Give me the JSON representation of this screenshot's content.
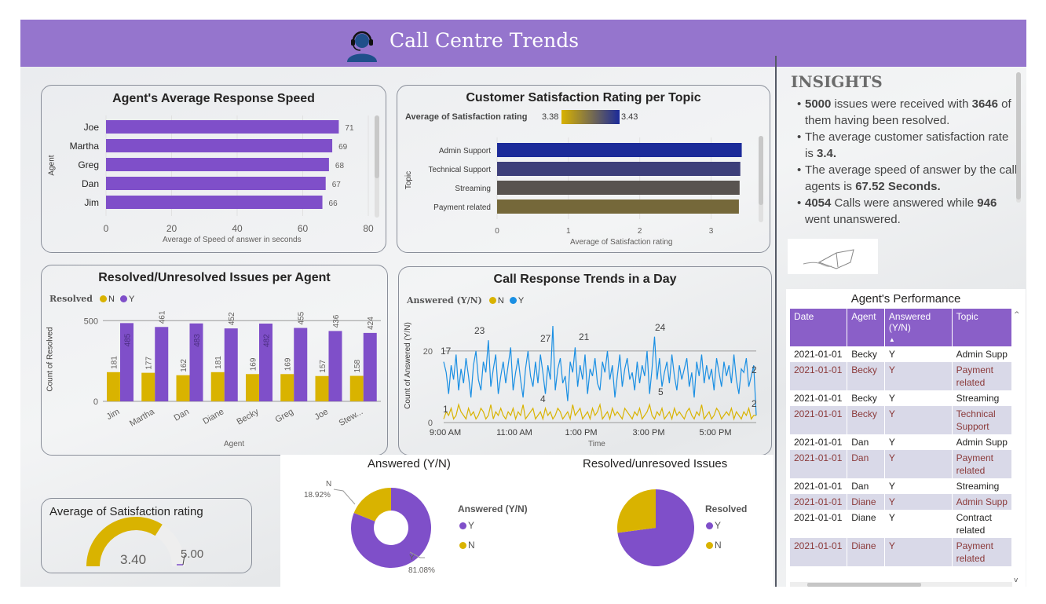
{
  "header": {
    "title": "Call Centre Trends",
    "logo_icon": "headset-agent-icon"
  },
  "colors": {
    "purple": "#7f4fc9",
    "gold": "#d9b300",
    "blue": "#1a8fe3",
    "navy": "#1b2a8f"
  },
  "response_speed": {
    "title": "Agent's Average Response Speed",
    "ylabel": "Agent",
    "xlabel": "Average of Speed of answer in seconds",
    "x_ticks": [
      "0",
      "20",
      "40",
      "60",
      "80"
    ],
    "chart_data": {
      "type": "bar",
      "categories": [
        "Joe",
        "Martha",
        "Greg",
        "Dan",
        "Jim"
      ],
      "values": [
        71,
        69,
        68,
        67,
        66
      ],
      "xlim": [
        0,
        80
      ]
    }
  },
  "satisfaction_topic": {
    "title": "Customer Satisfaction Rating per Topic",
    "legend_title": "Average of Satisfaction rating",
    "legend_min": "3.38",
    "legend_max": "3.43",
    "ylabel": "Topic",
    "xlabel": "Average of Satisfaction rating",
    "x_ticks": [
      "0",
      "1",
      "2",
      "3"
    ],
    "chart_data": {
      "type": "bar",
      "categories": [
        "Admin Support",
        "Technical Support",
        "Streaming",
        "Payment related"
      ],
      "values": [
        3.43,
        3.41,
        3.4,
        3.39
      ],
      "colors": [
        "#1c2b99",
        "#3d3f7a",
        "#585350",
        "#75683a"
      ],
      "xlim": [
        0,
        3.6
      ]
    }
  },
  "resolved_agent": {
    "title": "Resolved/Unresolved Issues per Agent",
    "legend_title": "Resolved",
    "legend_n": "N",
    "legend_y": "Y",
    "ylabel": "Count of Resolved",
    "xlabel": "Agent",
    "y_ticks": [
      "0",
      "500"
    ],
    "chart_data": {
      "type": "bar",
      "categories": [
        "Jim",
        "Martha",
        "Dan",
        "Diane",
        "Becky",
        "Greg",
        "Joe",
        "Stew..."
      ],
      "series": [
        {
          "name": "N",
          "values": [
            181,
            177,
            162,
            181,
            169,
            169,
            157,
            158
          ]
        },
        {
          "name": "Y",
          "values": [
            485,
            461,
            483,
            452,
            482,
            455,
            436,
            424
          ]
        }
      ],
      "ylim": [
        0,
        550
      ]
    }
  },
  "call_trends": {
    "title": "Call Response Trends in a Day",
    "legend_title": "Answered (Y/N)",
    "legend_n": "N",
    "legend_y": "Y",
    "ylabel": "Count of Answered (Y/N)",
    "xlabel": "Time",
    "y_ticks": [
      "0",
      "20"
    ],
    "x_ticks": [
      "9:00 AM",
      "11:00 AM",
      "1:00 PM",
      "3:00 PM",
      "5:00 PM"
    ],
    "annotations": [
      "17",
      "23",
      "27",
      "21",
      "24",
      "2",
      "2",
      "1",
      "4",
      "5"
    ],
    "chart_data": {
      "type": "line",
      "x_range": [
        "9:00 AM",
        "6:00 PM"
      ],
      "ylim": [
        0,
        27
      ],
      "series": [
        {
          "name": "Y",
          "values": [
            17,
            14,
            8,
            16,
            12,
            19,
            9,
            15,
            11,
            18,
            13,
            7,
            16,
            20,
            12,
            9,
            17,
            14,
            23,
            10,
            15,
            19,
            8,
            13,
            17,
            11,
            16,
            21,
            9,
            14,
            18,
            12,
            7,
            15,
            20,
            13,
            10,
            17,
            11,
            19,
            14,
            8,
            16,
            12,
            27,
            9,
            15,
            18,
            11,
            13,
            6,
            17,
            14,
            21,
            10,
            16,
            12,
            19,
            8,
            15,
            13,
            18,
            11,
            9,
            17,
            14,
            20,
            12,
            16,
            7,
            13,
            19,
            10,
            15,
            18,
            12,
            14,
            9,
            17,
            11,
            16,
            13,
            20,
            8,
            15,
            24,
            12,
            18,
            10,
            14,
            17,
            11,
            19,
            13,
            9,
            16,
            12,
            15,
            18,
            10,
            14,
            7,
            17,
            13,
            19,
            11,
            16,
            12,
            15,
            9,
            18,
            14,
            10,
            17,
            13,
            16,
            11,
            19,
            12,
            8,
            15,
            14,
            18,
            10,
            13,
            16,
            2
          ]
        },
        {
          "name": "N",
          "values": [
            1,
            3,
            2,
            4,
            1,
            2,
            5,
            3,
            2,
            1,
            4,
            2,
            3,
            1,
            2,
            4,
            3,
            1,
            2,
            5,
            1,
            3,
            2,
            4,
            2,
            1,
            3,
            2,
            4,
            1,
            3,
            2,
            5,
            1,
            2,
            3,
            4,
            1,
            2,
            3,
            1,
            4,
            2,
            3,
            1,
            2,
            4,
            3,
            1,
            2,
            3,
            1,
            5,
            2,
            3,
            4,
            1,
            2,
            3,
            1,
            4,
            2,
            3,
            5,
            1,
            2,
            3,
            1,
            4,
            2,
            3,
            2,
            1,
            4,
            3,
            2,
            1,
            3,
            2,
            4,
            1,
            2,
            3,
            5,
            2,
            1,
            3,
            2,
            4,
            1,
            2,
            3,
            1,
            4,
            2,
            3,
            2,
            1,
            3,
            4,
            2,
            1,
            3,
            2,
            5,
            1,
            2,
            3,
            1,
            2,
            4,
            3,
            1,
            2,
            3,
            2,
            4,
            1,
            3,
            2,
            1,
            3,
            2,
            4,
            1,
            2,
            2
          ]
        }
      ]
    }
  },
  "avg_satisfaction": {
    "title": "Average of Satisfaction rating",
    "value": "3.40",
    "max": "5.00",
    "chart_data": {
      "type": "gauge",
      "value": 3.4,
      "min": 0,
      "max": 5
    }
  },
  "answered_donut": {
    "title": "Answered (Y/N)",
    "legend_title": "Answered (Y/N)",
    "legend_y": "Y",
    "legend_n": "N",
    "label_n": "N",
    "label_n_pct": "18.92%",
    "label_y": "Y",
    "label_y_pct": "81.08%",
    "chart_data": {
      "type": "pie",
      "categories": [
        "Y",
        "N"
      ],
      "values": [
        81.08,
        18.92
      ]
    }
  },
  "resolved_donut": {
    "title": "Resolved/unresoved Issues",
    "legend_title": "Resolved",
    "legend_y": "Y",
    "legend_n": "N",
    "chart_data": {
      "type": "pie",
      "categories": [
        "Y",
        "N"
      ],
      "values": [
        72.92,
        27.08
      ]
    }
  },
  "insights": {
    "title": "INSIGHTS",
    "l1a": "5000",
    "l1b": " issues were received with ",
    "l1c": "3646",
    "l1d": " of them having been resolved.",
    "l2a": "The average customer satisfaction rate is ",
    "l2b": "3.4.",
    "l3a": "The average speed of answer by the call agents is ",
    "l3b": "67.52 Seconds.",
    "l4a": "4054",
    "l4b": " Calls were answered while ",
    "l4c": "946",
    "l4d": " went unanswered.",
    "image_icon": "laptop-sketch-icon"
  },
  "performance": {
    "title": "Agent's Performance",
    "columns": [
      "Date",
      "Agent",
      "Answered (Y/N)",
      "Topic"
    ],
    "rows": [
      [
        "2021-01-01",
        "Becky",
        "Y",
        "Admin Supp"
      ],
      [
        "2021-01-01",
        "Becky",
        "Y",
        "Payment related"
      ],
      [
        "2021-01-01",
        "Becky",
        "Y",
        "Streaming"
      ],
      [
        "2021-01-01",
        "Becky",
        "Y",
        "Technical Support"
      ],
      [
        "2021-01-01",
        "Dan",
        "Y",
        "Admin Supp"
      ],
      [
        "2021-01-01",
        "Dan",
        "Y",
        "Payment related"
      ],
      [
        "2021-01-01",
        "Dan",
        "Y",
        "Streaming"
      ],
      [
        "2021-01-01",
        "Diane",
        "Y",
        "Admin Supp"
      ],
      [
        "2021-01-01",
        "Diane",
        "Y",
        "Contract related"
      ],
      [
        "2021-01-01",
        "Diane",
        "Y",
        "Payment related"
      ]
    ]
  }
}
